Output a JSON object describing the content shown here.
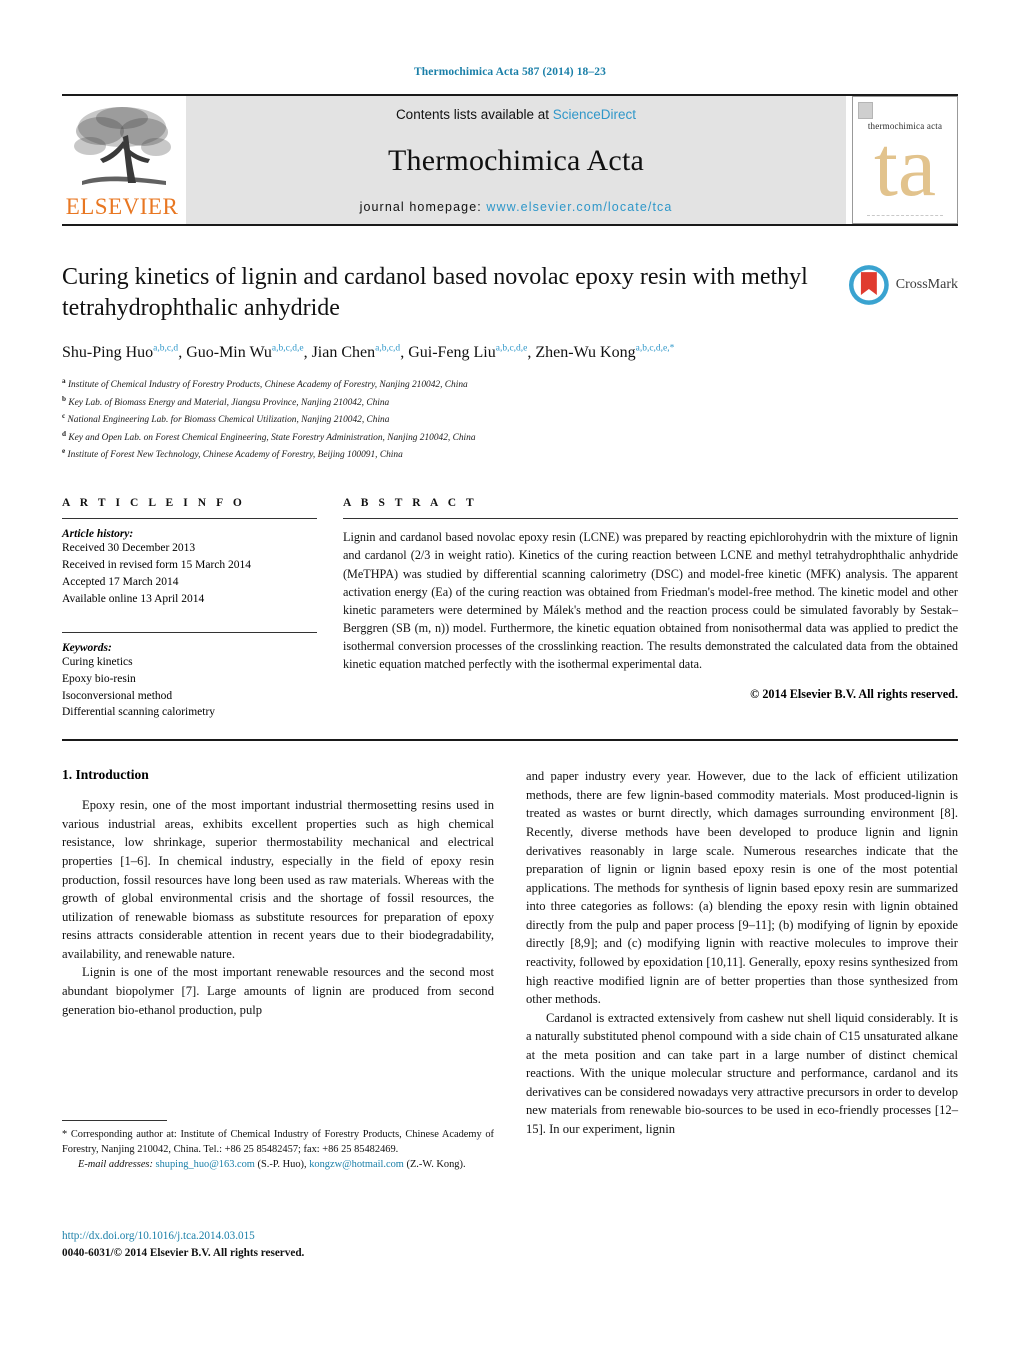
{
  "running_head": "Thermochimica Acta 587 (2014) 18–23",
  "masthead": {
    "publisher": "ELSEVIER",
    "contents_prefix": "Contents lists available at ",
    "contents_link": "ScienceDirect",
    "journal_title": "Thermochimica Acta",
    "homepage_prefix": "journal homepage: ",
    "homepage_url": "www.elsevier.com/locate/tca",
    "cover_journal_name": "thermochimica acta",
    "cover_monogram": "ta"
  },
  "crossmark": {
    "label": "CrossMark"
  },
  "article": {
    "title": "Curing kinetics of lignin and cardanol based novolac epoxy resin with methyl tetrahydrophthalic anhydride",
    "authors": [
      {
        "name": "Shu-Ping Huo",
        "marks": "a,b,c,d",
        "sep": ", "
      },
      {
        "name": "Guo-Min Wu",
        "marks": "a,b,c,d,e",
        "sep": ", "
      },
      {
        "name": "Jian Chen",
        "marks": "a,b,c,d",
        "sep": ", "
      },
      {
        "name": "Gui-Feng Liu",
        "marks": "a,b,c,d,e",
        "sep": ", "
      },
      {
        "name": "Zhen-Wu Kong",
        "marks": "a,b,c,d,e,*",
        "sep": ""
      }
    ],
    "affiliations": [
      {
        "mark": "a",
        "text": "Institute of Chemical Industry of Forestry Products, Chinese Academy of Forestry, Nanjing 210042, China"
      },
      {
        "mark": "b",
        "text": "Key Lab. of Biomass Energy and Material, Jiangsu Province, Nanjing 210042, China"
      },
      {
        "mark": "c",
        "text": "National Engineering Lab. for Biomass Chemical Utilization, Nanjing 210042, China"
      },
      {
        "mark": "d",
        "text": "Key and Open Lab. on Forest Chemical Engineering, State Forestry Administration, Nanjing 210042, China"
      },
      {
        "mark": "e",
        "text": "Institute of Forest New Technology, Chinese Academy of Forestry, Beijing 100091, China"
      }
    ]
  },
  "article_info": {
    "heading": "A R T I C L E   I N F O",
    "history_label": "Article history:",
    "history": [
      "Received 30 December 2013",
      "Received in revised form 15 March 2014",
      "Accepted 17 March 2014",
      "Available online 13 April 2014"
    ],
    "keywords_label": "Keywords:",
    "keywords": [
      "Curing kinetics",
      "Epoxy bio-resin",
      "Isoconversional method",
      "Differential scanning calorimetry"
    ]
  },
  "abstract": {
    "heading": "A B S T R A C T",
    "text": "Lignin and cardanol based novolac epoxy resin (LCNE) was prepared by reacting epichlorohydrin with the mixture of lignin and cardanol (2/3 in weight ratio). Kinetics of the curing reaction between LCNE and methyl tetrahydrophthalic anhydride (MeTHPA) was studied by differential scanning calorimetry (DSC) and model-free kinetic (MFK) analysis. The apparent activation energy (Ea) of the curing reaction was obtained from Friedman's model-free method. The kinetic model and other kinetic parameters were determined by Málek's method and the reaction process could be simulated favorably by Sestak–Berggren (SB (m, n)) model. Furthermore, the kinetic equation obtained from nonisothermal data was applied to predict the isothermal conversion processes of the crosslinking reaction. The results demonstrated the calculated data from the obtained kinetic equation matched perfectly with the isothermal experimental data.",
    "copyright": "© 2014 Elsevier B.V. All rights reserved."
  },
  "introduction": {
    "heading": "1. Introduction",
    "left_paragraphs": [
      "Epoxy resin, one of the most important industrial thermosetting resins used in various industrial areas, exhibits excellent properties such as high chemical resistance, low shrinkage, superior thermostability mechanical and electrical properties [1–6]. In chemical industry, especially in the field of epoxy resin production, fossil resources have long been used as raw materials. Whereas with the growth of global environmental crisis and the shortage of fossil resources, the utilization of renewable biomass as substitute resources for preparation of epoxy resins attracts considerable attention in recent years due to their biodegradability, availability, and renewable nature.",
      "Lignin is one of the most important renewable resources and the second most abundant biopolymer [7]. Large amounts of lignin are produced from second generation bio-ethanol production, pulp"
    ],
    "right_paragraphs": [
      "and paper industry every year. However, due to the lack of efficient utilization methods, there are few lignin-based commodity materials. Most produced-lignin is treated as wastes or burnt directly, which damages surrounding environment [8]. Recently, diverse methods have been developed to produce lignin and lignin derivatives reasonably in large scale. Numerous researches indicate that the preparation of lignin or lignin based epoxy resin is one of the most potential applications. The methods for synthesis of lignin based epoxy resin are summarized into three categories as follows: (a) blending the epoxy resin with lignin obtained directly from the pulp and paper process [9–11]; (b) modifying of lignin by epoxide directly [8,9]; and (c) modifying lignin with reactive molecules to improve their reactivity, followed by epoxidation [10,11]. Generally, epoxy resins synthesized from high reactive modified lignin are of better properties than those synthesized from other methods.",
      "Cardanol is extracted extensively from cashew nut shell liquid considerably. It is a naturally substituted phenol compound with a side chain of C15 unsaturated alkane at the meta position and can take part in a large number of distinct chemical reactions. With the unique molecular structure and performance, cardanol and its derivatives can be considered nowadays very attractive precursors in order to develop new materials from renewable bio-sources to be used in eco-friendly processes [12–15]. In our experiment, lignin"
    ]
  },
  "footnotes": {
    "corresponding": "* Corresponding author at: Institute of Chemical Industry of Forestry Products, Chinese Academy of Forestry, Nanjing 210042, China. Tel.: +86 25 85482457; fax: +86 25 85482469.",
    "email_label": "E-mail addresses:",
    "email1": "shuping_huo@163.com",
    "email1_who": "(S.-P. Huo),",
    "email2": "kongzw@hotmail.com",
    "email2_who": "(Z.-W. Kong)."
  },
  "doi_block": {
    "doi": "http://dx.doi.org/10.1016/j.tca.2014.03.015",
    "issn": "0040-6031/© 2014 Elsevier B.V. All rights reserved."
  },
  "colors": {
    "link": "#1a7fa8",
    "sciencedirect": "#2f97c9",
    "elsevier_orange": "#E87722",
    "cover_tan": "#e2c38d"
  }
}
